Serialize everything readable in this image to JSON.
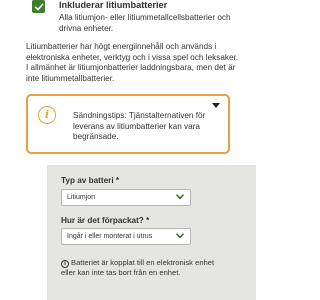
{
  "lithium_option": {
    "checked": true,
    "title": "Inkluderar litiumbatterier",
    "description": "Alla litiumjon- eller litiummetallcellsbatterier och drivna enheter."
  },
  "intro_text": "Litiumbatterier har högt energiinnehåll och används i elektroniska enheter, verktyg och i vissa spel och leksaker. I allmänhet är litiumjonbatterier laddningsbara, men det är inte litiummetallbatterier.",
  "notice": {
    "icon": "info-icon",
    "text": "Sändningstips: Tjänstalternativen för leverans av litiumbatterier kan vara begränsade.",
    "accent_color": "#e5a33f"
  },
  "battery_form": {
    "type_label": "Typ av batteri *",
    "type_value": "Litiumjon",
    "packing_label": "Hur är det förpackat? *",
    "packing_value": "Ingår i eller monterat i utrus",
    "help_text": "Batteriet är kopplat till en elektronisk enhet eller kan inte tas bort från en enhet.",
    "help_icon": "i"
  },
  "colors": {
    "checkbox": "#3e7d2b",
    "panel_background": "#e5e5e1",
    "select_chevron": "#2f6a20"
  }
}
